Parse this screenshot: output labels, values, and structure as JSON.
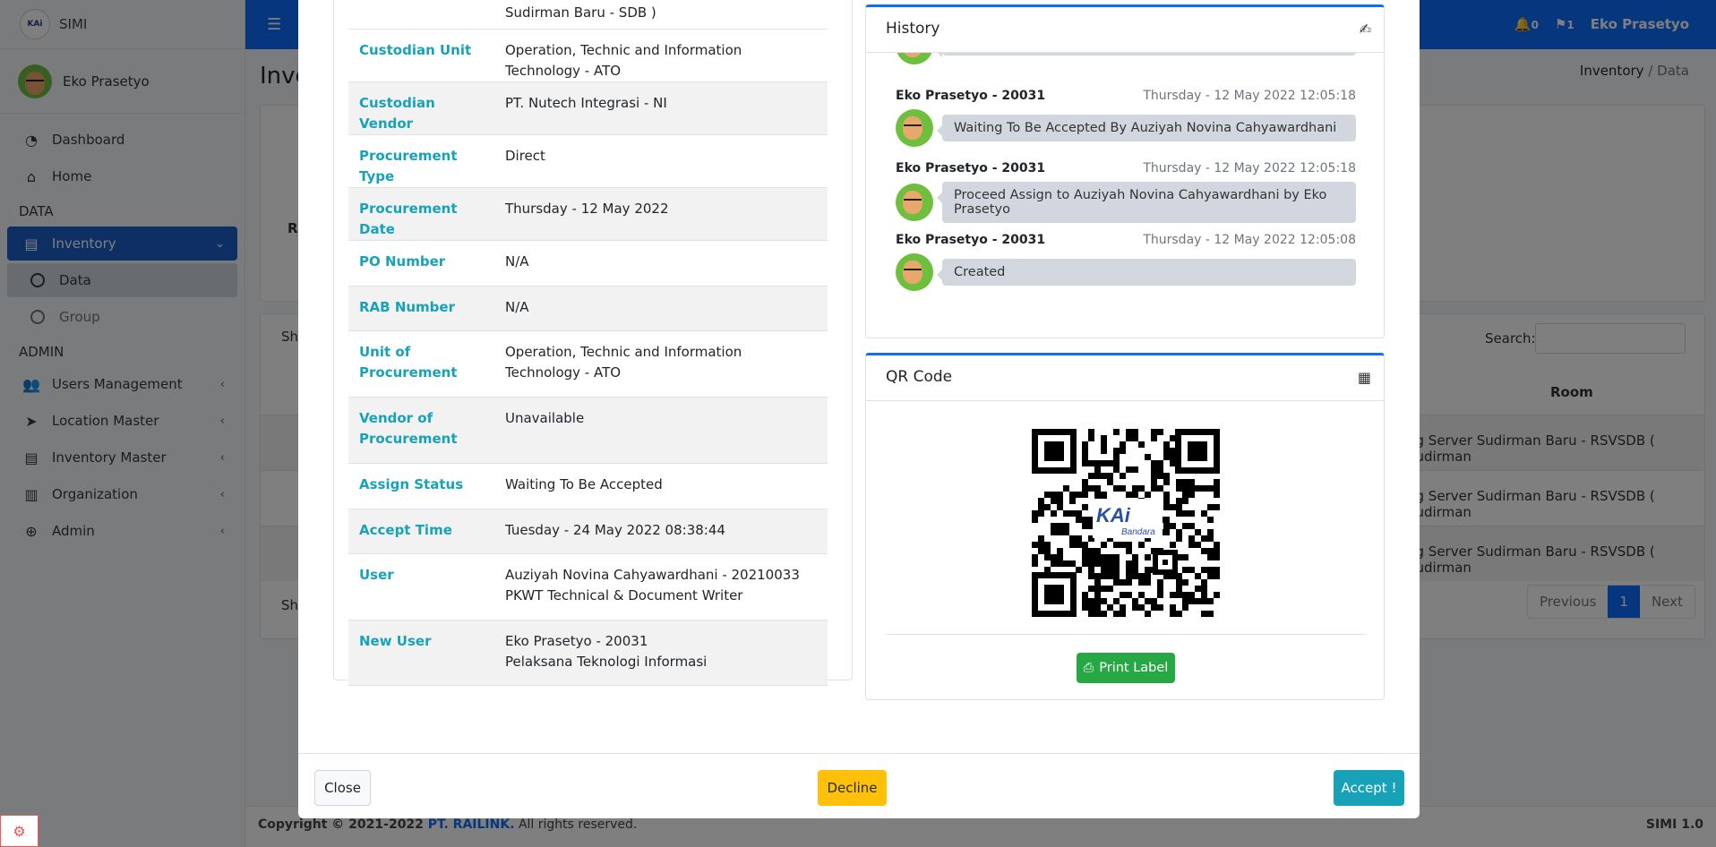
{
  "app": {
    "brand": "SIMI",
    "user_name": "Eko Prasetyo",
    "notif_bell_count": "0",
    "notif_flag_count": "1"
  },
  "sidebar": {
    "items": [
      {
        "label": "Dashboard",
        "icon": "dashboard-icon"
      },
      {
        "label": "Home",
        "icon": "home-icon"
      }
    ],
    "section_data": "DATA",
    "inventory": {
      "label": "Inventory",
      "sub": [
        "Data",
        "Group"
      ]
    },
    "section_admin": "ADMIN",
    "admin_items": [
      "Users Management",
      "Location Master",
      "Inventory Master",
      "Organization",
      "Admin"
    ]
  },
  "page": {
    "title": "Inve",
    "breadcrumb_1": "Inventory",
    "breadcrumb_sep": "/",
    "breadcrumb_2": "Data",
    "search_label": "Search:",
    "room_header": "Room",
    "room_cells": [
      "ng Server Sudirman Baru - RSVSDB ( Sudirman",
      "ng Server Sudirman Baru - RSVSDB ( Sudirman",
      "ng Server Sudirman Baru - RSVSDB ( Sudirman"
    ],
    "show_top": "Sho",
    "show_bottom": "Sho",
    "filter_label": "R",
    "pagination": {
      "prev": "Previous",
      "current": "1",
      "next": "Next"
    }
  },
  "footer": {
    "copyright_prefix": "Copyright © 2021-2022 ",
    "company": "PT. RAILINK.",
    "suffix": " All rights reserved.",
    "version": "SIMI 1.0"
  },
  "details": {
    "top_overflow_value": "Sudirman Baru - SDB )",
    "rows": [
      {
        "key": "Custodian Unit",
        "value": "Operation, Technic and Information Technology - ATO",
        "value2": ""
      },
      {
        "key": "Custodian Vendor",
        "value": "PT. Nutech Integrasi - NI",
        "value2": ""
      },
      {
        "key": "Procurement Type",
        "value": "Direct",
        "value2": ""
      },
      {
        "key": "Procurement Date",
        "value": "Thursday - 12 May 2022",
        "value2": ""
      },
      {
        "key": "PO Number",
        "value": "N/A",
        "value2": ""
      },
      {
        "key": "RAB Number",
        "value": "N/A",
        "value2": ""
      },
      {
        "key": "Unit of Procurement",
        "value": "Operation, Technic and Information Technology - ATO",
        "value2": ""
      },
      {
        "key": "Vendor of Procurement",
        "value": "Unavailable",
        "value2": ""
      },
      {
        "key": "Assign Status",
        "value": "Waiting To Be Accepted",
        "value2": ""
      },
      {
        "key": "Accept Time",
        "value": "Tuesday - 24 May 2022 08:38:44",
        "value2": ""
      },
      {
        "key": "User",
        "value": "Auziyah Novina Cahyawardhani - 20210033",
        "value2": "PKWT Technical & Document Writer"
      },
      {
        "key": "New User",
        "value": "Eko Prasetyo - 20031",
        "value2": "Pelaksana Teknologi Informasi"
      }
    ]
  },
  "history": {
    "title": "History",
    "entries": [
      {
        "who": "Eko Prasetyo - 20031",
        "when": "Thursday - 12 May 2022 12:05:18",
        "text": "Waiting To Be Accepted By Auziyah Novina Cahyawardhani"
      },
      {
        "who": "Eko Prasetyo - 20031",
        "when": "Thursday - 12 May 2022 12:05:18",
        "text": "Proceed Assign to Auziyah Novina Cahyawardhani by Eko Prasetyo"
      },
      {
        "who": "Eko Prasetyo - 20031",
        "when": "Thursday - 12 May 2022 12:05:08",
        "text": "Created"
      }
    ]
  },
  "qr": {
    "title": "QR Code",
    "logo_text": "KAi",
    "logo_sub": "Bandara",
    "print_label": "Print Label"
  },
  "modal_footer": {
    "close": "Close",
    "decline": "Decline",
    "accept": "Accept !"
  },
  "colors": {
    "primary": "#0d6efd",
    "info": "#17a2b8",
    "warning": "#ffc107",
    "success": "#28a745"
  }
}
